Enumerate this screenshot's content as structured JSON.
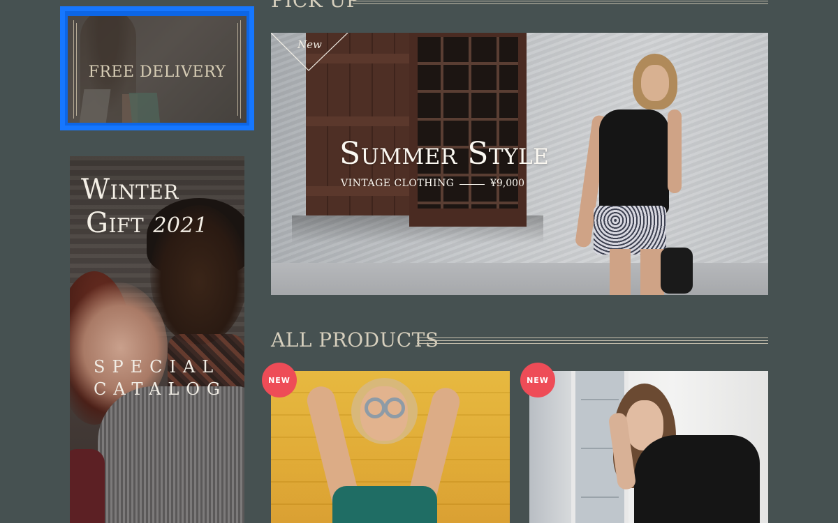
{
  "delivery_banner": {
    "text": "FREE DELIVERY"
  },
  "pickup": {
    "title": "PICK UP"
  },
  "winter_banner": {
    "title_line1": "Winter",
    "title_line2": "Gift",
    "year": "2021",
    "special": "SPECIAL",
    "catalog": "CATALOG"
  },
  "summer_banner": {
    "tag": "New",
    "title": "Summer Style",
    "subtitle": "VINTAGE CLOTHING",
    "price": "¥9,000"
  },
  "all_products": {
    "title": "ALL PRODUCTS",
    "items": [
      {
        "badge": "NEW"
      },
      {
        "badge": "NEW"
      }
    ]
  },
  "colors": {
    "background": "#465151",
    "focus_outline": "#1677ff",
    "new_badge": "#ee4c57",
    "heading_text": "#d6cfbd"
  }
}
